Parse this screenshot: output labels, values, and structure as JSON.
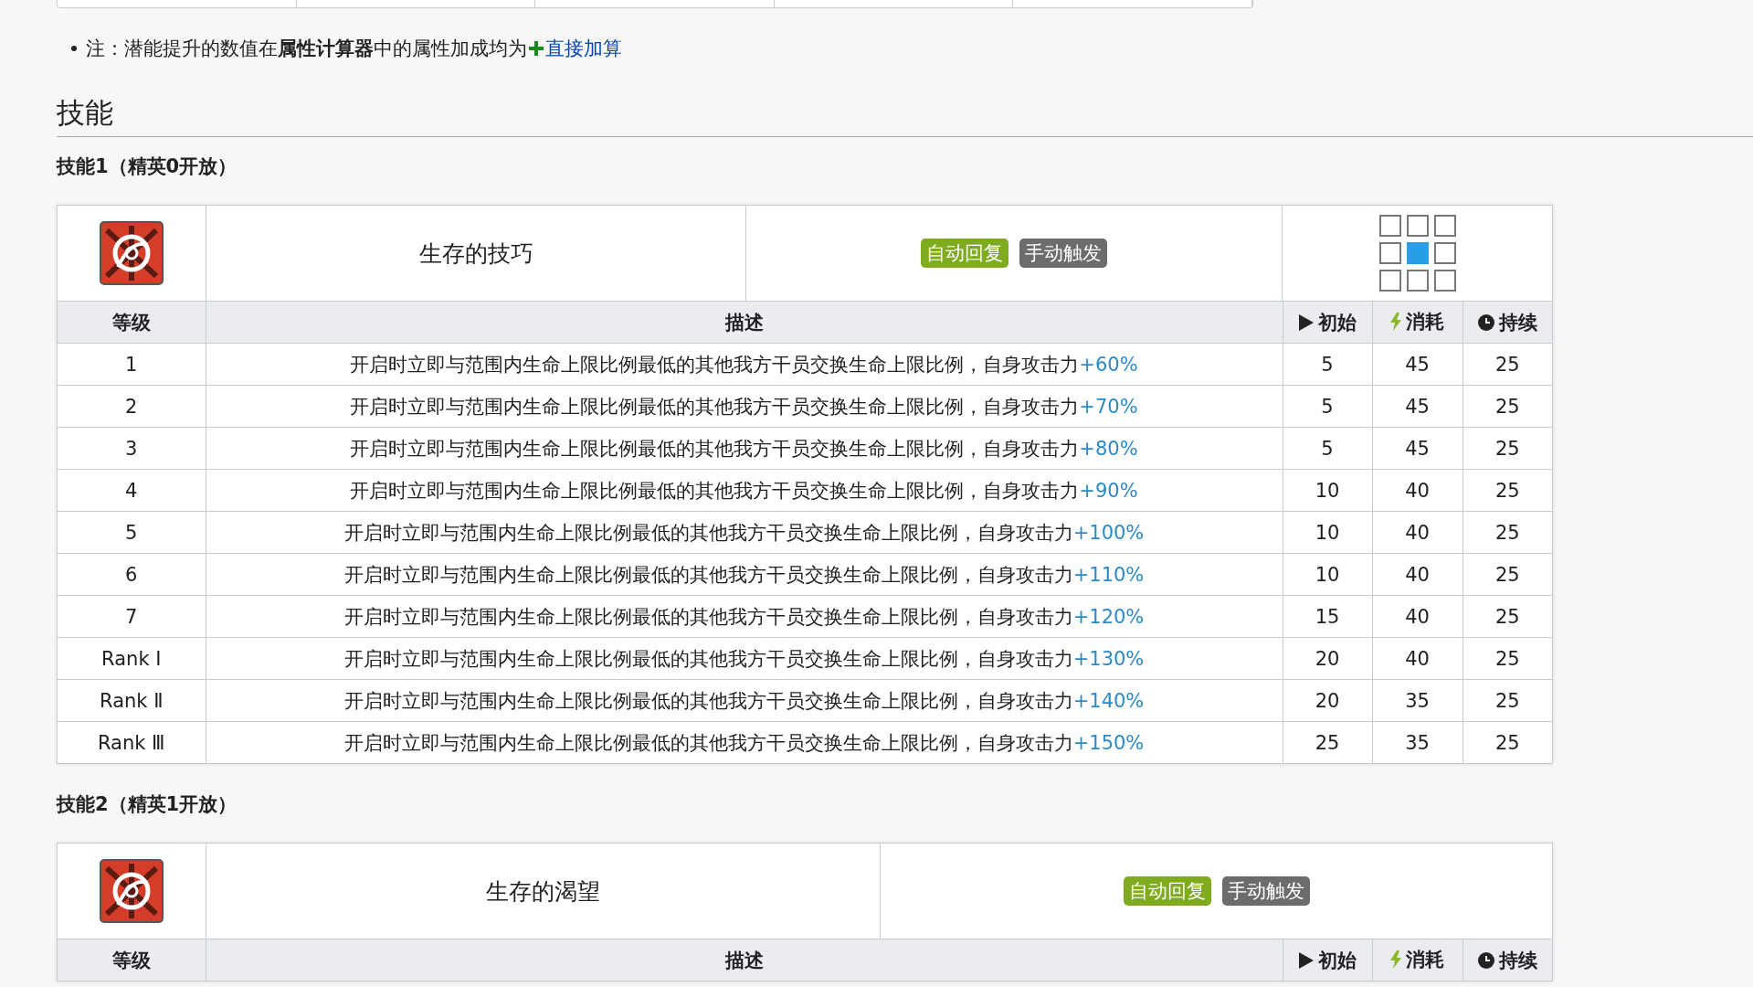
{
  "note": {
    "text": "注：潜能提升的数值在**属性计算器**中的属性加成均为",
    "link": "直接加算"
  },
  "section_title": "技能",
  "skills": [
    {
      "title": "技能1（精英0开放）",
      "name": "生存的技巧",
      "tags": [
        {
          "label": "自动回复",
          "kind": "recovery"
        },
        {
          "label": "手动触发",
          "kind": "trigger"
        }
      ],
      "range": [
        {
          "active": false
        },
        {
          "active": false
        },
        {
          "active": false
        },
        {
          "active": false
        },
        {
          "active": true
        },
        {
          "active": false
        },
        {
          "active": false
        },
        {
          "active": false
        },
        {
          "active": false
        }
      ],
      "columns": [
        "等级",
        "描述",
        "初始",
        "消耗",
        "持续"
      ],
      "rows": [
        {
          "level": "1",
          "text": "开启时立即与范围内生命上限比例最低的其他我方干员交换生命上限比例，自身攻击力",
          "value": "+60%",
          "initial": "5",
          "cost": "45",
          "duration": "25"
        },
        {
          "level": "2",
          "text": "开启时立即与范围内生命上限比例最低的其他我方干员交换生命上限比例，自身攻击力",
          "value": "+70%",
          "initial": "5",
          "cost": "45",
          "duration": "25"
        },
        {
          "level": "3",
          "text": "开启时立即与范围内生命上限比例最低的其他我方干员交换生命上限比例，自身攻击力",
          "value": "+80%",
          "initial": "5",
          "cost": "45",
          "duration": "25"
        },
        {
          "level": "4",
          "text": "开启时立即与范围内生命上限比例最低的其他我方干员交换生命上限比例，自身攻击力",
          "value": "+90%",
          "initial": "10",
          "cost": "40",
          "duration": "25"
        },
        {
          "level": "5",
          "text": "开启时立即与范围内生命上限比例最低的其他我方干员交换生命上限比例，自身攻击力",
          "value": "+100%",
          "initial": "10",
          "cost": "40",
          "duration": "25"
        },
        {
          "level": "6",
          "text": "开启时立即与范围内生命上限比例最低的其他我方干员交换生命上限比例，自身攻击力",
          "value": "+110%",
          "initial": "10",
          "cost": "40",
          "duration": "25"
        },
        {
          "level": "7",
          "text": "开启时立即与范围内生命上限比例最低的其他我方干员交换生命上限比例，自身攻击力",
          "value": "+120%",
          "initial": "15",
          "cost": "40",
          "duration": "25"
        },
        {
          "level": "Rank Ⅰ",
          "text": "开启时立即与范围内生命上限比例最低的其他我方干员交换生命上限比例，自身攻击力",
          "value": "+130%",
          "initial": "20",
          "cost": "40",
          "duration": "25"
        },
        {
          "level": "Rank Ⅱ",
          "text": "开启时立即与范围内生命上限比例最低的其他我方干员交换生命上限比例，自身攻击力",
          "value": "+140%",
          "initial": "20",
          "cost": "35",
          "duration": "25"
        },
        {
          "level": "Rank Ⅲ",
          "text": "开启时立即与范围内生命上限比例最低的其他我方干员交换生命上限比例，自身攻击力",
          "value": "+150%",
          "initial": "25",
          "cost": "35",
          "duration": "25"
        }
      ]
    },
    {
      "title": "技能2（精英1开放）",
      "name": "生存的渴望",
      "tags": [
        {
          "label": "自动回复",
          "kind": "recovery"
        },
        {
          "label": "手动触发",
          "kind": "trigger"
        }
      ],
      "columns": [
        "等级",
        "描述",
        "初始",
        "消耗",
        "持续"
      ]
    }
  ]
}
